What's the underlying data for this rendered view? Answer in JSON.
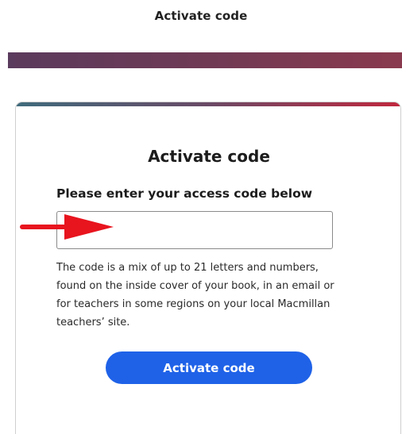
{
  "header": {
    "title": "Activate code"
  },
  "card": {
    "title": "Activate code",
    "field_label": "Please enter your access code below",
    "input_value": "",
    "input_placeholder": "",
    "help_text": "The code is a mix of up to 21 letters and numbers, found on the inside cover of your book, in an email or for teachers in some regions on your local Macmillan teachers’ site.",
    "button_label": "Activate code"
  },
  "colors": {
    "banner": "#6d3a55",
    "button": "#1f62e8",
    "arrow": "#e8141e"
  },
  "annotations": {
    "arrow_icon": "red-arrow-pointing-right"
  }
}
